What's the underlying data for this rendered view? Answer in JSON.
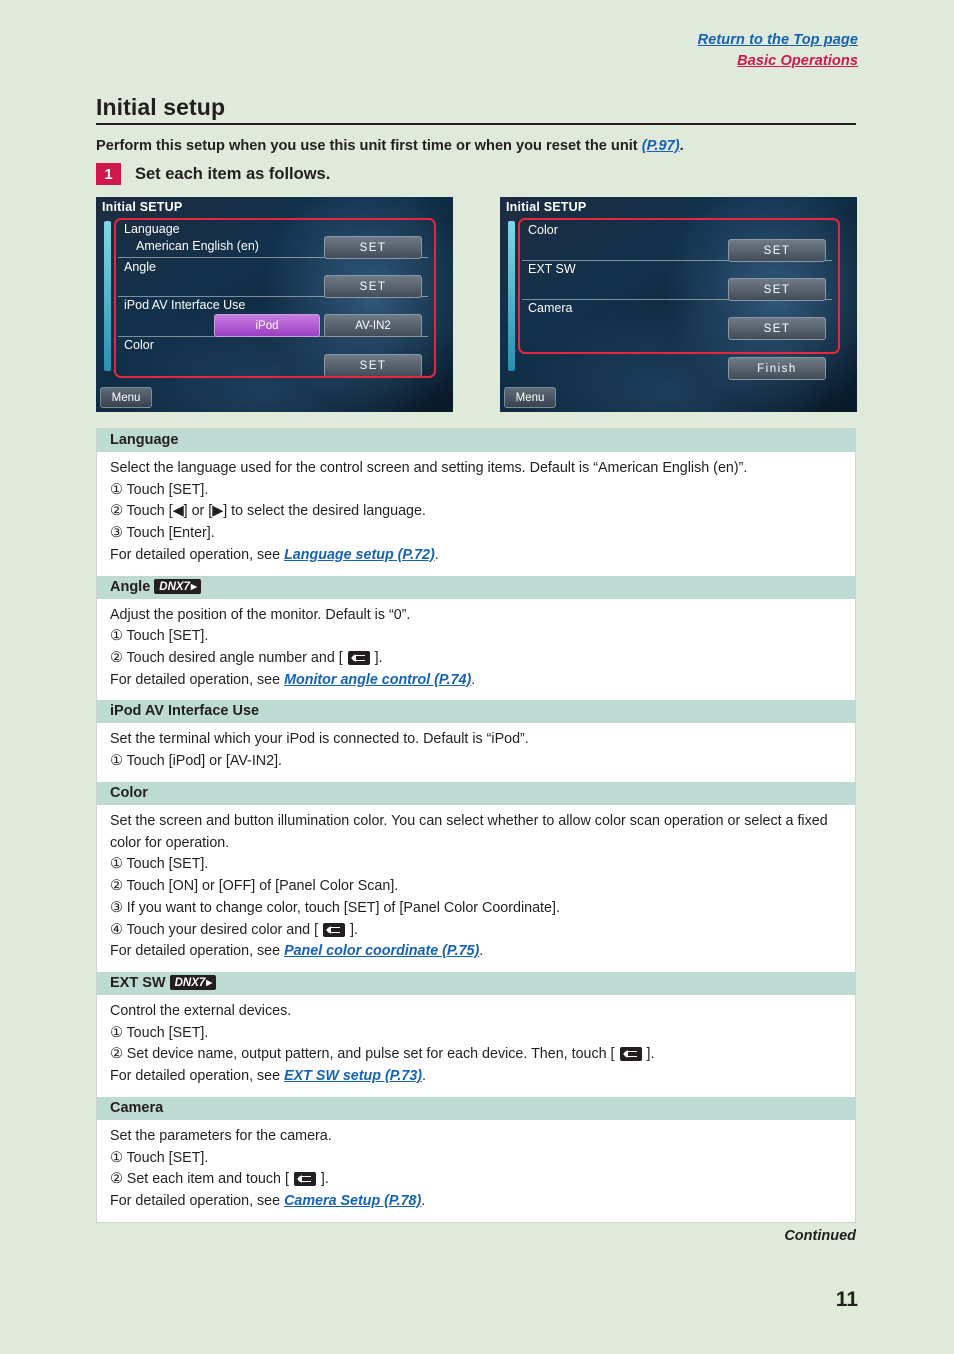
{
  "top_links": {
    "return_top": "Return to the Top page",
    "basic_operations": "Basic Operations"
  },
  "page": {
    "title": "Initial setup",
    "intro_text": "Perform this setup when you use this unit first time or when you reset the unit ",
    "intro_link": "(P.97)",
    "intro_period": ".",
    "step_number": "1",
    "step_text": "Set each item as follows.",
    "continued": "Continued",
    "page_number": "11"
  },
  "screenshot_left": {
    "header": "Initial SETUP",
    "menu_button": "Menu",
    "rows": [
      {
        "label": "Language",
        "value": "American English (en)",
        "button": "SET"
      },
      {
        "label": "Angle",
        "button": "SET"
      },
      {
        "label": "iPod AV Interface Use",
        "option_a": "iPod",
        "option_b": "AV-IN2"
      },
      {
        "label": "Color",
        "button": "SET"
      }
    ]
  },
  "screenshot_right": {
    "header": "Initial SETUP",
    "menu_button": "Menu",
    "rows": [
      {
        "label": "Color",
        "button": "SET"
      },
      {
        "label": "EXT SW",
        "button": "SET"
      },
      {
        "label": "Camera",
        "button": "SET"
      }
    ],
    "finish_button": "Finish"
  },
  "sections": [
    {
      "heading": "Language",
      "badge": "",
      "lines": [
        "Select the language used for the control screen and setting items. Default is “American English (en)”.",
        "① Touch [SET].",
        "② Touch [◀] or [▶] to select the desired language.",
        "③ Touch [Enter]."
      ],
      "detail_prefix": "For detailed operation, see ",
      "detail_link": "Language setup (P.72)",
      "detail_suffix": "."
    },
    {
      "heading": "Angle",
      "badge": "DNX7",
      "lines": [
        "Adjust the position of the monitor. Default is “0”.",
        "① Touch [SET].",
        "② Touch desired angle number and [ RETURN_ICON ]."
      ],
      "detail_prefix": "For detailed operation, see ",
      "detail_link": "Monitor angle control (P.74)",
      "detail_suffix": "."
    },
    {
      "heading": "iPod AV Interface Use",
      "badge": "",
      "lines": [
        "Set the terminal which your iPod is connected to. Default is “iPod”.",
        "① Touch [iPod] or [AV-IN2]."
      ],
      "detail_prefix": "",
      "detail_link": "",
      "detail_suffix": ""
    },
    {
      "heading": "Color",
      "badge": "",
      "lines": [
        "Set the screen and button illumination color. You can select whether to allow color scan operation or select a fixed color for operation.",
        "① Touch [SET].",
        "② Touch [ON] or [OFF] of [Panel Color Scan].",
        "③ If you want to change color, touch [SET] of [Panel Color Coordinate].",
        "④ Touch your desired color and [ RETURN_ICON ]."
      ],
      "detail_prefix": "For detailed operation, see ",
      "detail_link": "Panel color coordinate (P.75)",
      "detail_suffix": "."
    },
    {
      "heading": "EXT SW",
      "badge": "DNX7",
      "lines": [
        "Control the external devices.",
        "① Touch [SET].",
        "② Set device name, output pattern, and pulse set for each device. Then, touch [ RETURN_ICON ]."
      ],
      "detail_prefix": "For detailed operation, see ",
      "detail_link": "EXT SW setup (P.73)",
      "detail_suffix": "."
    },
    {
      "heading": "Camera",
      "badge": "",
      "lines": [
        "Set the parameters for the camera.",
        "① Touch [SET].",
        "② Set each item and touch [ RETURN_ICON ]."
      ],
      "detail_prefix": "For detailed operation, see ",
      "detail_link": "Camera Setup (P.78)",
      "detail_suffix": "."
    }
  ],
  "colors": {
    "page_bg": "#dfeadb",
    "link_blue": "#1562b4",
    "link_red": "#d2174d",
    "section_head": "#bddbd3",
    "highlight_box": "#e8263c"
  }
}
